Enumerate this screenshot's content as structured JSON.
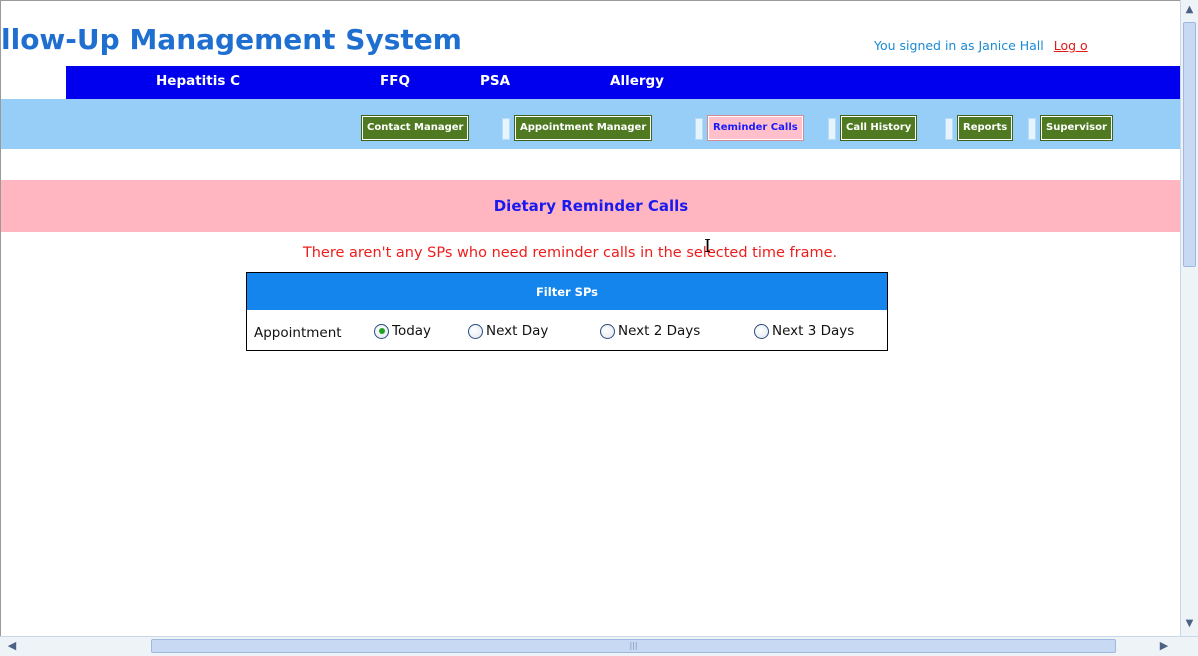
{
  "header": {
    "app_title": "llow-Up Management System",
    "signed_in_text": "You signed in as Janice Hall",
    "logout_label": "Log o"
  },
  "main_nav": {
    "items": [
      {
        "label": "Hepatitis C"
      },
      {
        "label": "FFQ"
      },
      {
        "label": "PSA"
      },
      {
        "label": "Allergy"
      }
    ]
  },
  "sub_nav": {
    "tabs": [
      {
        "label": "Contact Manager",
        "active": false
      },
      {
        "label": "Appointment Manager",
        "active": false
      },
      {
        "label": "Reminder Calls",
        "active": true
      },
      {
        "label": "Call History",
        "active": false
      },
      {
        "label": "Reports",
        "active": false
      },
      {
        "label": "Supervisor",
        "active": false
      }
    ]
  },
  "page": {
    "title": "Dietary Reminder Calls",
    "message": "There aren't any SPs who need reminder calls in the selected time frame."
  },
  "filter": {
    "title": "Filter SPs",
    "label": "Appointment",
    "options": [
      {
        "label": "Today",
        "checked": true
      },
      {
        "label": "Next Day",
        "checked": false
      },
      {
        "label": "Next 2 Days",
        "checked": false
      },
      {
        "label": "Next 3 Days",
        "checked": false
      }
    ]
  },
  "colors": {
    "title": "#1f6fd1",
    "main_nav_bg": "#0000ee",
    "sub_band_bg": "#96cef7",
    "tab_bg": "#4f7a22",
    "active_tab_bg": "#ffc0cb",
    "page_band_bg": "#ffb6c1",
    "message": "#ee1c1c",
    "filter_head_bg": "#1585ee"
  },
  "icons": {
    "scroll_up": "triangle-up",
    "scroll_down": "triangle-down",
    "scroll_left": "triangle-left",
    "scroll_right": "triangle-right",
    "cursor": "text-cursor-ibeam"
  }
}
